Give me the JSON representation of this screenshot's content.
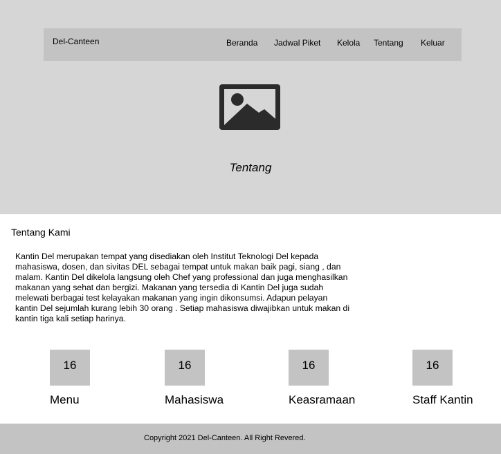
{
  "navbar": {
    "brand": "Del-Canteen",
    "items": [
      {
        "label": "Beranda"
      },
      {
        "label": "Jadwal Piket"
      },
      {
        "label": "Kelola"
      },
      {
        "label": "Tentang"
      },
      {
        "label": "Keluar"
      }
    ]
  },
  "hero": {
    "image_icon": "image-placeholder-icon",
    "title": "Tentang"
  },
  "about": {
    "heading": "Tentang Kami",
    "paragraph_lines": [
      "Kantin Del merupakan tempat yang disediakan oleh Institut Teknologi Del kepada",
      "mahasiswa, dosen, dan sivitas DEL sebagai tempat untuk makan baik pagi, siang , dan",
      "malam. Kantin Del dikelola langsung oleh Chef yang professional dan juga menghasilkan",
      "makanan yang sehat dan bergizi. Makanan yang tersedia di Kantin Del juga sudah",
      "melewati berbagai test kelayakan makanan yang ingin dikonsumsi. Adapun pelayan",
      "kantin Del sejumlah kurang lebih 30 orang . Setiap mahasiswa diwajibkan untuk makan di",
      "kantin tiga kali setiap harinya."
    ]
  },
  "stats": [
    {
      "value": "16",
      "label": "Menu"
    },
    {
      "value": "16",
      "label": "Mahasiswa"
    },
    {
      "value": "16",
      "label": "Keasramaan"
    },
    {
      "value": "16",
      "label": "Staff Kantin"
    }
  ],
  "footer": {
    "copyright": "Copyright 2021 Del-Canteen. All Right Revered."
  },
  "colors": {
    "hero_bg": "#d6d6d6",
    "bar_bg": "#c3c3c3",
    "icon": "#2b2b2b"
  }
}
